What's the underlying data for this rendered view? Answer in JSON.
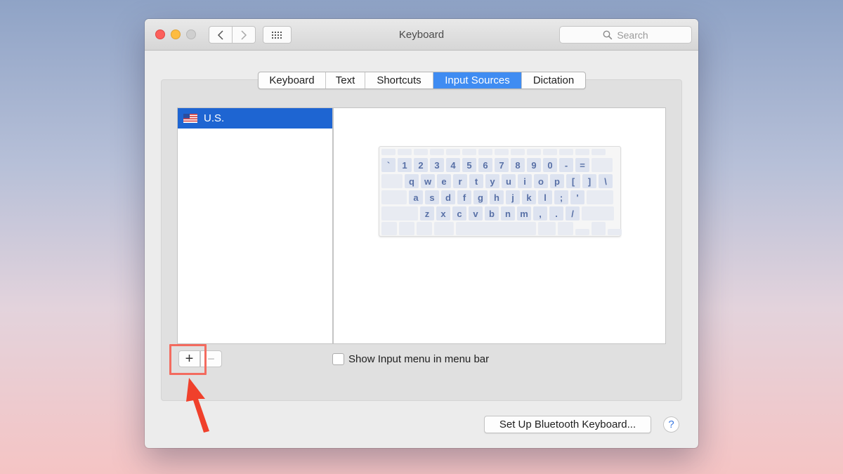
{
  "window": {
    "title": "Keyboard",
    "search_placeholder": "Search"
  },
  "tabs": [
    {
      "label": "Keyboard",
      "active": false
    },
    {
      "label": "Text",
      "active": false
    },
    {
      "label": "Shortcuts",
      "active": false
    },
    {
      "label": "Input Sources",
      "active": true
    },
    {
      "label": "Dictation",
      "active": false
    }
  ],
  "input_sources": {
    "items": [
      {
        "label": "U.S.",
        "icon": "us-flag-icon",
        "selected": true
      }
    ]
  },
  "keyboard_preview": {
    "row1": [
      "`",
      "1",
      "2",
      "3",
      "4",
      "5",
      "6",
      "7",
      "8",
      "9",
      "0",
      "-",
      "="
    ],
    "row2": [
      "q",
      "w",
      "e",
      "r",
      "t",
      "y",
      "u",
      "i",
      "o",
      "p",
      "[",
      "]",
      "\\"
    ],
    "row3": [
      "a",
      "s",
      "d",
      "f",
      "g",
      "h",
      "j",
      "k",
      "l",
      ";",
      "'"
    ],
    "row4": [
      "z",
      "x",
      "c",
      "v",
      "b",
      "n",
      "m",
      ",",
      ".",
      "/"
    ]
  },
  "controls": {
    "add_label": "+",
    "remove_label": "−",
    "show_menu_label": "Show Input menu in menu bar",
    "show_menu_checked": false,
    "bluetooth_button": "Set Up Bluetooth Keyboard...",
    "help_label": "?"
  },
  "colors": {
    "accent": "#3f8cf2",
    "selection": "#1e65d2",
    "annotation": "#f36b5f"
  }
}
